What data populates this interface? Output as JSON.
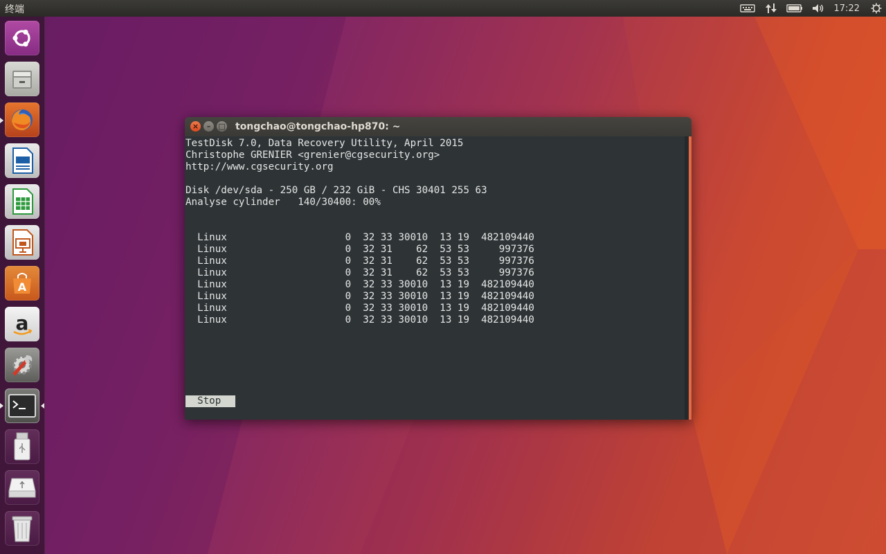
{
  "panel": {
    "app_title": "终端",
    "clock": "17:22",
    "indicators": [
      "keyboard-icon",
      "network-icon",
      "battery-icon",
      "volume-icon",
      "power-icon"
    ]
  },
  "launcher": {
    "items": [
      {
        "name": "ubuntu-dash",
        "icon": "ubuntu-logo-icon"
      },
      {
        "name": "files",
        "icon": "file-cabinet-icon"
      },
      {
        "name": "firefox",
        "icon": "firefox-icon"
      },
      {
        "name": "writer",
        "icon": "libreoffice-writer-icon"
      },
      {
        "name": "calc",
        "icon": "libreoffice-calc-icon"
      },
      {
        "name": "impress",
        "icon": "libreoffice-impress-icon"
      },
      {
        "name": "software",
        "icon": "software-center-icon"
      },
      {
        "name": "amazon",
        "icon": "amazon-icon"
      },
      {
        "name": "settings",
        "icon": "system-settings-icon"
      },
      {
        "name": "terminal",
        "icon": "terminal-icon"
      },
      {
        "name": "usb",
        "icon": "usb-drive-icon"
      },
      {
        "name": "removable",
        "icon": "removable-drive-icon"
      },
      {
        "name": "trash",
        "icon": "trash-icon"
      }
    ]
  },
  "window": {
    "title": "tongchao@tongchao-hp870: ~"
  },
  "terminal": {
    "header": [
      "TestDisk 7.0, Data Recovery Utility, April 2015",
      "Christophe GRENIER <grenier@cgsecurity.org>",
      "http://www.cgsecurity.org"
    ],
    "disk_line": "Disk /dev/sda - 250 GB / 232 GiB - CHS 30401 255 63",
    "analyse_line": "Analyse cylinder   140/30400: 00%",
    "partitions": [
      "  Linux                    0  32 33 30010  13 19  482109440",
      "  Linux                    0  32 31    62  53 53     997376",
      "  Linux                    0  32 31    62  53 53     997376",
      "  Linux                    0  32 31    62  53 53     997376",
      "  Linux                    0  32 33 30010  13 19  482109440",
      "  Linux                    0  32 33 30010  13 19  482109440",
      "  Linux                    0  32 33 30010  13 19  482109440",
      "  Linux                    0  32 33 30010  13 19  482109440"
    ],
    "stop_label": "  Stop  "
  },
  "colors": {
    "terminal_bg": "#2e3436",
    "terminal_fg": "#e6e6e6",
    "accent": "#e06b46",
    "panel_bg": "#3c3b37"
  }
}
